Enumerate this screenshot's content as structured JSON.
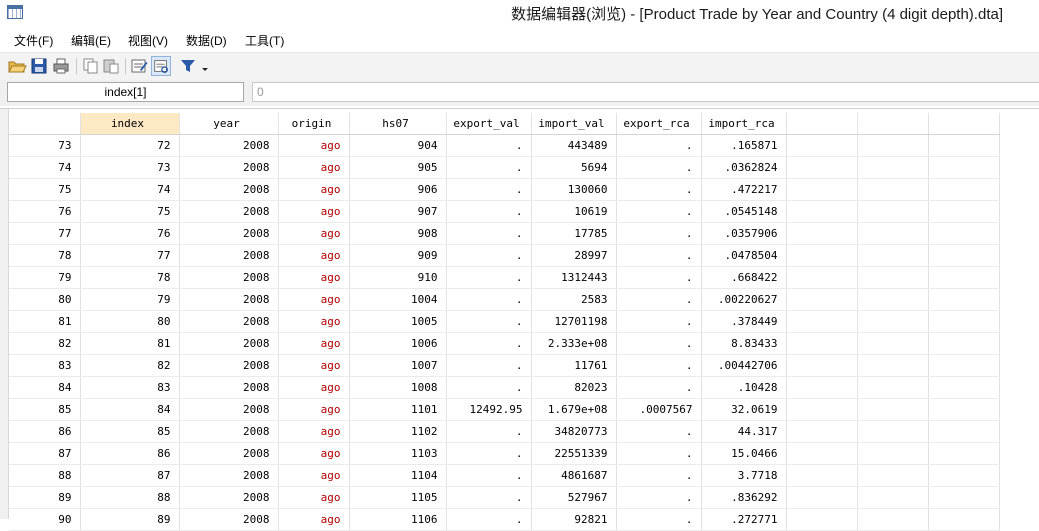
{
  "window": {
    "title": "数据编辑器(浏览) - [Product Trade by Year and Country (4 digit depth).dta]",
    "icon": "data-grid-icon"
  },
  "menu": [
    {
      "label": "文件(F)"
    },
    {
      "label": "编辑(E)"
    },
    {
      "label": "视图(V)"
    },
    {
      "label": "数据(D)"
    },
    {
      "label": "工具(T)"
    }
  ],
  "toolbar": {
    "buttons": [
      "open-folder-icon",
      "save-disk-icon",
      "print-icon",
      "copy-icon",
      "paste-icon",
      "edit-mode-icon",
      "browse-mode-icon",
      "filter-icon"
    ],
    "accent": "#2a5aa8"
  },
  "cellbar": {
    "name": "index[1]",
    "value": "0"
  },
  "grid": {
    "columns": [
      "index",
      "year",
      "origin",
      "hs07",
      "export_val",
      "import_val",
      "export_rca",
      "import_rca"
    ],
    "selected_column": "index",
    "rows": [
      {
        "n": "73",
        "index": "72",
        "year": "2008",
        "origin": "ago",
        "hs07": "904",
        "export_val": ".",
        "import_val": "443489",
        "export_rca": ".",
        "import_rca": ".165871"
      },
      {
        "n": "74",
        "index": "73",
        "year": "2008",
        "origin": "ago",
        "hs07": "905",
        "export_val": ".",
        "import_val": "5694",
        "export_rca": ".",
        "import_rca": ".0362824"
      },
      {
        "n": "75",
        "index": "74",
        "year": "2008",
        "origin": "ago",
        "hs07": "906",
        "export_val": ".",
        "import_val": "130060",
        "export_rca": ".",
        "import_rca": ".472217"
      },
      {
        "n": "76",
        "index": "75",
        "year": "2008",
        "origin": "ago",
        "hs07": "907",
        "export_val": ".",
        "import_val": "10619",
        "export_rca": ".",
        "import_rca": ".0545148"
      },
      {
        "n": "77",
        "index": "76",
        "year": "2008",
        "origin": "ago",
        "hs07": "908",
        "export_val": ".",
        "import_val": "17785",
        "export_rca": ".",
        "import_rca": ".0357906"
      },
      {
        "n": "78",
        "index": "77",
        "year": "2008",
        "origin": "ago",
        "hs07": "909",
        "export_val": ".",
        "import_val": "28997",
        "export_rca": ".",
        "import_rca": ".0478504"
      },
      {
        "n": "79",
        "index": "78",
        "year": "2008",
        "origin": "ago",
        "hs07": "910",
        "export_val": ".",
        "import_val": "1312443",
        "export_rca": ".",
        "import_rca": ".668422"
      },
      {
        "n": "80",
        "index": "79",
        "year": "2008",
        "origin": "ago",
        "hs07": "1004",
        "export_val": ".",
        "import_val": "2583",
        "export_rca": ".",
        "import_rca": ".00220627"
      },
      {
        "n": "81",
        "index": "80",
        "year": "2008",
        "origin": "ago",
        "hs07": "1005",
        "export_val": ".",
        "import_val": "12701198",
        "export_rca": ".",
        "import_rca": ".378449"
      },
      {
        "n": "82",
        "index": "81",
        "year": "2008",
        "origin": "ago",
        "hs07": "1006",
        "export_val": ".",
        "import_val": "2.333e+08",
        "export_rca": ".",
        "import_rca": "8.83433"
      },
      {
        "n": "83",
        "index": "82",
        "year": "2008",
        "origin": "ago",
        "hs07": "1007",
        "export_val": ".",
        "import_val": "11761",
        "export_rca": ".",
        "import_rca": ".00442706"
      },
      {
        "n": "84",
        "index": "83",
        "year": "2008",
        "origin": "ago",
        "hs07": "1008",
        "export_val": ".",
        "import_val": "82023",
        "export_rca": ".",
        "import_rca": ".10428"
      },
      {
        "n": "85",
        "index": "84",
        "year": "2008",
        "origin": "ago",
        "hs07": "1101",
        "export_val": "12492.95",
        "import_val": "1.679e+08",
        "export_rca": ".0007567",
        "import_rca": "32.0619"
      },
      {
        "n": "86",
        "index": "85",
        "year": "2008",
        "origin": "ago",
        "hs07": "1102",
        "export_val": ".",
        "import_val": "34820773",
        "export_rca": ".",
        "import_rca": "44.317"
      },
      {
        "n": "87",
        "index": "86",
        "year": "2008",
        "origin": "ago",
        "hs07": "1103",
        "export_val": ".",
        "import_val": "22551339",
        "export_rca": ".",
        "import_rca": "15.0466"
      },
      {
        "n": "88",
        "index": "87",
        "year": "2008",
        "origin": "ago",
        "hs07": "1104",
        "export_val": ".",
        "import_val": "4861687",
        "export_rca": ".",
        "import_rca": "3.7718"
      },
      {
        "n": "89",
        "index": "88",
        "year": "2008",
        "origin": "ago",
        "hs07": "1105",
        "export_val": ".",
        "import_val": "527967",
        "export_rca": ".",
        "import_rca": ".836292"
      },
      {
        "n": "90",
        "index": "89",
        "year": "2008",
        "origin": "ago",
        "hs07": "1106",
        "export_val": ".",
        "import_val": "92821",
        "export_rca": ".",
        "import_rca": ".272771"
      }
    ],
    "string_color": "#b00000",
    "header_selected_color": "#fde9c4"
  }
}
